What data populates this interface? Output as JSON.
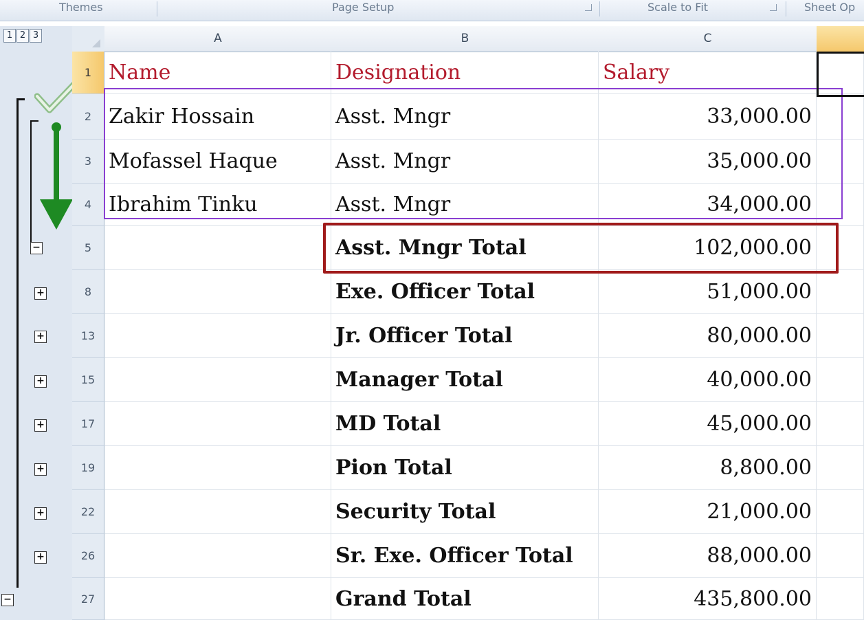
{
  "ribbon": {
    "groups": [
      "Themes",
      "Page Setup",
      "Scale to Fit",
      "Sheet Op"
    ]
  },
  "outline_levels": [
    "1",
    "2",
    "3"
  ],
  "columns": [
    "A",
    "B",
    "C"
  ],
  "header_row": {
    "row_number": "1",
    "name": "Name",
    "designation": "Designation",
    "salary": "Salary"
  },
  "detail_rows": [
    {
      "row_number": "2",
      "name": "Zakir Hossain",
      "designation": "Asst. Mngr",
      "salary": "33,000.00"
    },
    {
      "row_number": "3",
      "name": "Mofassel Haque",
      "designation": "Asst. Mngr",
      "salary": "35,000.00"
    },
    {
      "row_number": "4",
      "name": "Ibrahim Tinku",
      "designation": "Asst. Mngr",
      "salary": "34,000.00"
    }
  ],
  "total_rows": [
    {
      "row_number": "5",
      "label": "Asst. Mngr Total",
      "value": "102,000.00",
      "toggle": "−"
    },
    {
      "row_number": "8",
      "label": "Exe. Officer Total",
      "value": "51,000.00",
      "toggle": "+"
    },
    {
      "row_number": "13",
      "label": "Jr. Officer Total",
      "value": "80,000.00",
      "toggle": "+"
    },
    {
      "row_number": "15",
      "label": "Manager Total",
      "value": "40,000.00",
      "toggle": "+"
    },
    {
      "row_number": "17",
      "label": "MD Total",
      "value": "45,000.00",
      "toggle": "+"
    },
    {
      "row_number": "19",
      "label": "Pion Total",
      "value": "8,800.00",
      "toggle": "+"
    },
    {
      "row_number": "22",
      "label": "Security Total",
      "value": "21,000.00",
      "toggle": "+"
    },
    {
      "row_number": "26",
      "label": "Sr. Exe. Officer Total",
      "value": "88,000.00",
      "toggle": "+"
    },
    {
      "row_number": "27",
      "label": "Grand Total",
      "value": "435,800.00",
      "toggle": "−"
    }
  ],
  "colors": {
    "header_text": "#b31b2d",
    "highlight_group": "#8a3fd1",
    "highlight_total": "#a01a1a",
    "arrow": "#1e8a23"
  }
}
